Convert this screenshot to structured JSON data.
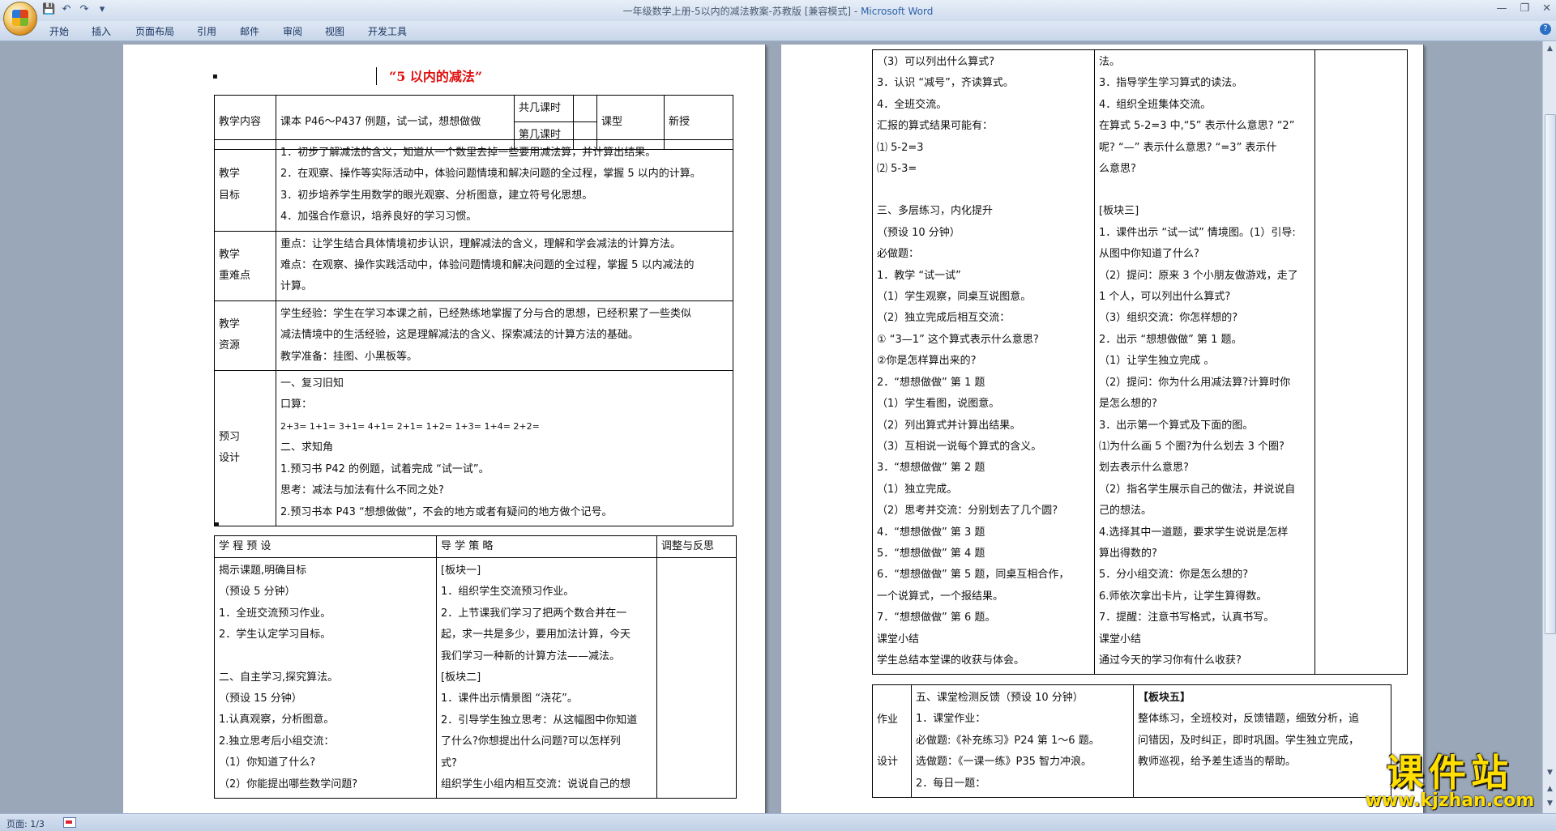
{
  "window": {
    "title_doc": "一年级数学上册-5以内的减法教案-苏教版 [兼容模式] - ",
    "title_app": "Microsoft Word",
    "controls": [
      "—",
      "❐",
      "✕"
    ],
    "help": "?"
  },
  "qat": [
    "💾",
    "↶",
    "↷",
    "▾"
  ],
  "ribbon_tabs": [
    "开始",
    "插入",
    "页面布局",
    "引用",
    "邮件",
    "审阅",
    "视图",
    "开发工具"
  ],
  "status": {
    "page": "页面: 1/3"
  },
  "scroll": {
    "up": "▲",
    "down": "▼",
    "pageup": "▲",
    "pagedown": "▼"
  },
  "watermark": {
    "title": "课件站",
    "url": "www.kjzhan.com"
  },
  "page1": {
    "title": "“5 以内的减法”",
    "header": {
      "content_label": "教学内容",
      "content": "课本 P46～P437 例题，试一试，想想做做",
      "total_lessons": "共几课时",
      "lesson_no": "第几课时",
      "type_label": "课型",
      "type_value": "新授"
    },
    "objectives_label": [
      "教学",
      "目标"
    ],
    "objectives": [
      "1．初步了解减法的含义，知道从一个数里去掉一些要用减法算，并计算出结果。",
      "2．在观察、操作等实际活动中，体验问题情境和解决问题的全过程，掌握 5 以内的计算。",
      "3．初步培养学生用数学的眼光观察、分析图意，建立符号化思想。",
      "4．加强合作意识，培养良好的学习习惯。"
    ],
    "keypoints_label": [
      "教学",
      "重难点"
    ],
    "keypoints": [
      "重点：让学生结合具体情境初步认识，理解减法的含义，理解和学会减法的计算方法。",
      "难点：在观察、操作实践活动中，体验问题情境和解决问题的全过程，掌握 5 以内减法的",
      "计算。"
    ],
    "resources_label": [
      "教学",
      "资源"
    ],
    "resources": [
      "学生经验：学生在学习本课之前，已经熟练地掌握了分与合的思想，已经积累了一些类似",
      "减法情境中的生活经验，这是理解减法的含义、探索减法的计算方法的基础。",
      "教学准备：挂图、小黑板等。"
    ],
    "preview_label": [
      "预习",
      "设计"
    ],
    "preview": [
      "一、复习旧知",
      "口算：",
      "2+3=       1+1=      3+1=       4+1=       2+1=       1+2=       1+3=       1+4=     2+2=",
      "二、求知角",
      "1.预习书 P42 的例题，试着完成 “试一试”。",
      "思考：减法与加法有什么不同之处?",
      "2.预习书本 P43 “想想做做”，不会的地方或者有疑问的地方做个记号。"
    ],
    "process_headers": [
      "学 程 预 设",
      "导 学 策 略",
      "调整与反思"
    ],
    "process_left": [
      "揭示课题,明确目标",
      "（预设 5 分钟）",
      "1．全班交流预习作业。",
      "2．学生认定学习目标。",
      "",
      "二、自主学习,探究算法。",
      "（预设 15 分钟）",
      "1.认真观察，分析图意。",
      "2.独立思考后小组交流：",
      "（1）你知道了什么?",
      "（2）你能提出哪些数学问题?"
    ],
    "process_mid": [
      "[板块一]",
      "1．组织学生交流预习作业。",
      "2．上节课我们学习了把两个数合并在一",
      "起，求一共是多少，要用加法计算，今天",
      "我们学习一种新的计算方法——减法。",
      "[板块二]",
      "1．课件出示情景图 “浇花”。",
      "2．引导学生独立思考：从这幅图中你知道",
      "了什么?你想提出什么问题?可以怎样列",
      "式?",
      "组织学生小组内相互交流：说说自己的想"
    ]
  },
  "page2": {
    "left": [
      "（3）可以列出什么算式?",
      "3．认识 “减号”，齐读算式。",
      "4．全班交流。",
      "汇报的算式结果可能有：",
      "⑴ 5-2=3",
      "⑵ 5-3=",
      "",
      "三、多层练习，内化提升",
      "（预设 10 分钟）",
      "必做题：",
      "1．教学 “试一试”",
      "（1）学生观察，同桌互说图意。",
      "（2）独立完成后相互交流：",
      "① “3—1” 这个算式表示什么意思?",
      "②你是怎样算出来的?",
      "2．“想想做做” 第 1 题",
      "（1）学生看图，说图意。",
      "（2）列出算式并计算出结果。",
      "（3）互相说一说每个算式的含义。",
      "3．“想想做做” 第 2 题",
      "（1）独立完成。",
      "（2）思考并交流：分别划去了几个圆?",
      "4．“想想做做” 第 3 题",
      "5．“想想做做” 第 4 题",
      "6．“想想做做” 第 5 题，同桌互相合作，",
      "一个说算式，一个报结果。",
      "7．“想想做做” 第 6 题。",
      "课堂小结",
      "学生总结本堂课的收获与体会。"
    ],
    "mid": [
      "法。",
      "3．指导学生学习算式的读法。",
      "4．组织全班集体交流。",
      "在算式 5-2=3 中,“5” 表示什么意思? “2”",
      "呢? “—” 表示什么意思? “=3” 表示什",
      "么意思?",
      "",
      "[板块三]",
      "1．课件出示 “试一试” 情境图。(1）引导:",
      "从图中你知道了什么?",
      "（2）提问：原来 3 个小朋友做游戏，走了",
      "1 个人，可以列出什么算式?",
      "（3）组织交流：你怎样想的?",
      "2．出示 “想想做做” 第 1 题。",
      "（1）让学生独立完成 。",
      "（2）提问：你为什么用减法算?计算时你",
      "是怎么想的?",
      "3．出示第一个算式及下面的图。",
      "⑴为什么画 5 个圈?为什么划去 3 个圈?",
      "划去表示什么意思?",
      "（2）指名学生展示自己的做法，并说说自",
      "己的想法。",
      "4.选择其中一道题，要求学生说说是怎样",
      "算出得数的?",
      "5．分小组交流：你是怎么想的?",
      "6.师依次拿出卡片，让学生算得数。",
      "7．提醒：注意书写格式，认真书写。",
      "课堂小结",
      "通过今天的学习你有什么收获?"
    ],
    "homework_label": [
      "作业",
      "设计"
    ],
    "homework_left": [
      "五、课堂检测反馈（预设 10 分钟）",
      "1．课堂作业：",
      "必做题:《补充练习》P24 第 1～6 题。",
      "选做题：《一课一练》P35 智力冲浪。",
      "2．每日一题："
    ],
    "homework_right": [
      "【板块五】",
      "整体练习，全班校对，反馈错题，细致分析，追",
      "问错因，及时纠正，即时巩固。学生独立完成，",
      "教师巡视，给予差生适当的帮助。"
    ]
  }
}
